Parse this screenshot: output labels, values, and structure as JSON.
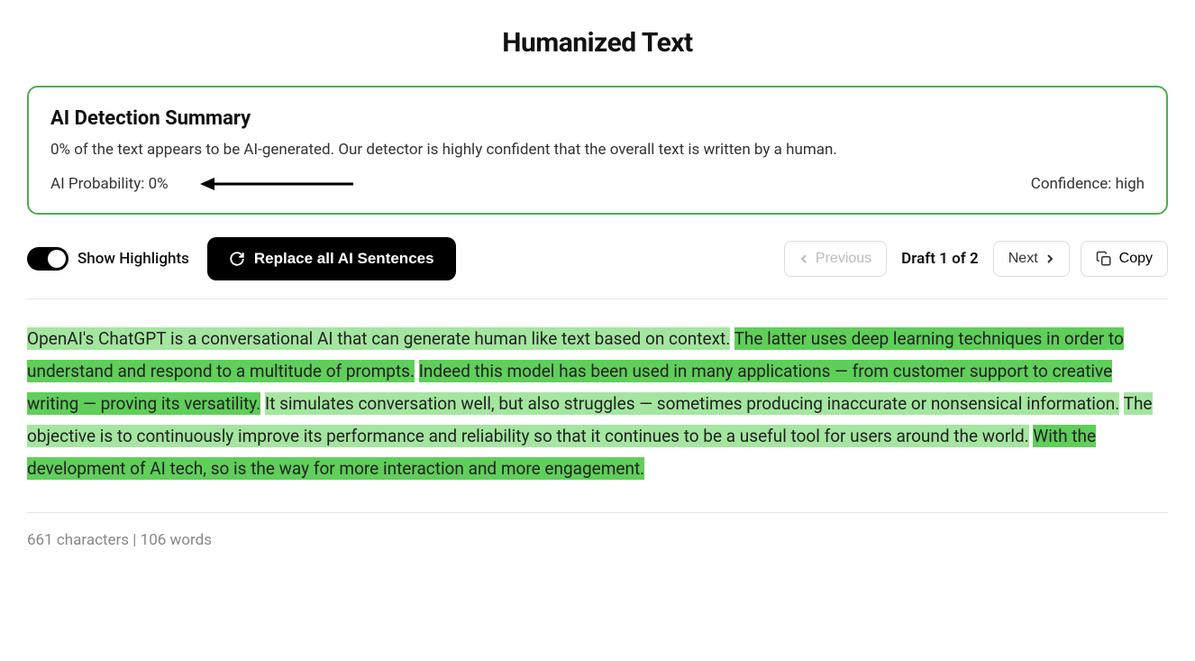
{
  "page": {
    "title": "Humanized Text"
  },
  "summary": {
    "heading": "AI Detection Summary",
    "description": "0% of the text appears to be AI-generated. Our detector is highly confident that the overall text is written by a human.",
    "probability_label": "AI Probability: 0%",
    "confidence_label": "Confidence: high"
  },
  "controls": {
    "show_highlights": "Show Highlights",
    "replace_all": "Replace all AI Sentences",
    "previous": "Previous",
    "draft_label": "Draft 1 of 2",
    "next": "Next",
    "copy": "Copy"
  },
  "sentences": [
    {
      "text": "OpenAI's ChatGPT is a conversational AI that can generate human like text based on context.",
      "shade": "light"
    },
    {
      "text": "The latter uses deep learning techniques in order to understand and respond to a multitude of prompts.",
      "shade": "dark"
    },
    {
      "text": "Indeed this model has been used in many applications — from customer support to creative writing — proving its versatility.",
      "shade": "dark"
    },
    {
      "text": "It simulates conversation well, but also struggles — sometimes producing inaccurate or nonsensical information.",
      "shade": "light"
    },
    {
      "text": "The objective is to continuously improve its performance and reliability so that it continues to be a useful tool for users around the world.",
      "shade": "light"
    },
    {
      "text": "With the development of AI tech, so is the way for more interaction and more engagement.",
      "shade": "dark"
    }
  ],
  "stats": {
    "label": "661 characters | 106 words"
  }
}
